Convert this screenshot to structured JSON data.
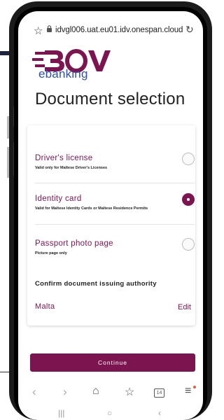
{
  "browser": {
    "url": "idvgl006.uat.eu01.idv.onespan.cloud"
  },
  "brand": {
    "logo_text": "BOV",
    "sub_text": "ebanking",
    "primary_color": "#7c1450",
    "secondary_color": "#2f4fb0"
  },
  "page": {
    "title": "Document selection"
  },
  "options": [
    {
      "label": "Driver's license",
      "note": "Valid only for Maltese Driver's Licenses",
      "selected": false
    },
    {
      "label": "Identity card",
      "note": "Valid for Maltese Identity Cards or Maltese Residence Permits",
      "selected": true
    },
    {
      "label": "Passport photo page",
      "note": "Picture page only",
      "selected": false
    }
  ],
  "authority": {
    "heading": "Confirm document issuing authority",
    "country": "Malta",
    "edit_label": "Edit"
  },
  "actions": {
    "continue_label": "Continue"
  },
  "browser_nav": {
    "tabs_count": "14"
  }
}
